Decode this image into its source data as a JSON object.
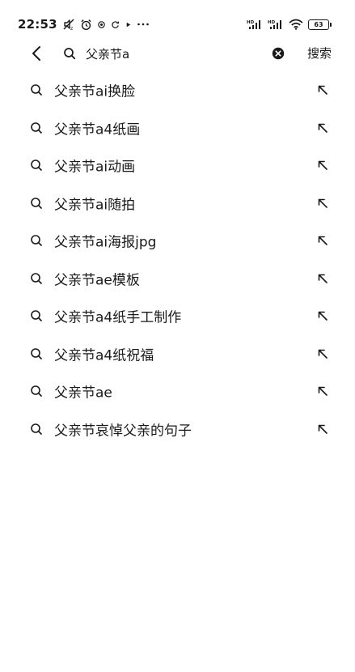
{
  "status_bar": {
    "time": "22:53",
    "icons": [
      "mute-icon",
      "alarm-icon",
      "location-icon",
      "sync-icon",
      "play-icon",
      "more-icon"
    ],
    "signal_icons": [
      "signal-hd-1-icon",
      "signal-hd-2-icon",
      "wifi-icon"
    ],
    "battery": "63"
  },
  "search": {
    "value": "父亲节a",
    "submit_label": "搜索",
    "back_icon": "chevron-left-icon",
    "search_icon": "search-icon",
    "clear_icon": "clear-icon"
  },
  "suggestions": [
    {
      "label": "父亲节ai换脸",
      "icon": "search-icon",
      "action_icon": "fill-arrow-icon"
    },
    {
      "label": "父亲节a4纸画",
      "icon": "search-icon",
      "action_icon": "fill-arrow-icon"
    },
    {
      "label": "父亲节ai动画",
      "icon": "search-icon",
      "action_icon": "fill-arrow-icon"
    },
    {
      "label": "父亲节ai随拍",
      "icon": "search-icon",
      "action_icon": "fill-arrow-icon"
    },
    {
      "label": "父亲节ai海报jpg",
      "icon": "search-icon",
      "action_icon": "fill-arrow-icon"
    },
    {
      "label": "父亲节ae模板",
      "icon": "search-icon",
      "action_icon": "fill-arrow-icon"
    },
    {
      "label": "父亲节a4纸手工制作",
      "icon": "search-icon",
      "action_icon": "fill-arrow-icon"
    },
    {
      "label": "父亲节a4纸祝福",
      "icon": "search-icon",
      "action_icon": "fill-arrow-icon"
    },
    {
      "label": "父亲节ae",
      "icon": "search-icon",
      "action_icon": "fill-arrow-icon"
    },
    {
      "label": "父亲节哀悼父亲的句子",
      "icon": "search-icon",
      "action_icon": "fill-arrow-icon"
    }
  ]
}
